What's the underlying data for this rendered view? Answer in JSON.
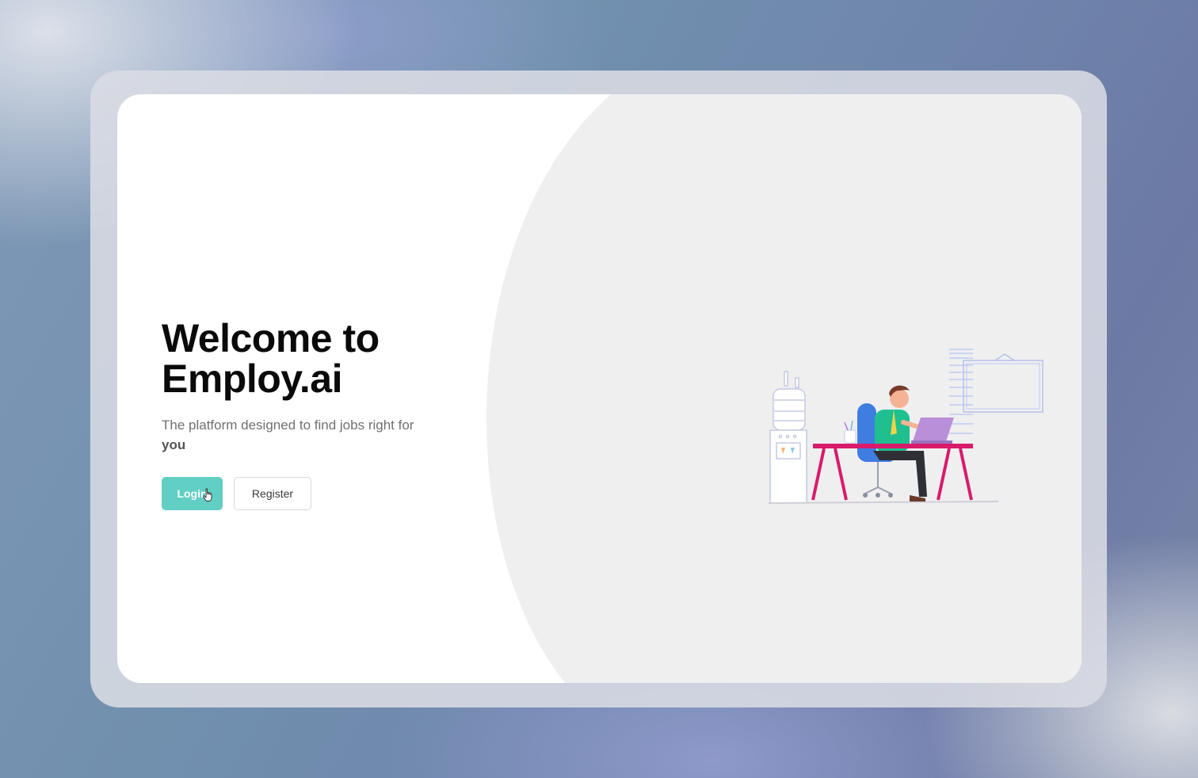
{
  "hero": {
    "title_line1": "Welcome to",
    "title_line2": "Employ.ai",
    "subtitle_text": "The platform designed to find jobs right for",
    "subtitle_emphasis": "you"
  },
  "actions": {
    "login_label": "Login",
    "register_label": "Register"
  },
  "colors": {
    "accent": "#62cfc4",
    "panel": "#efeff0",
    "desk": "#d81b6a",
    "laptop": "#b88fd8",
    "shirt": "#1fbf8f",
    "chair": "#3f7de0"
  },
  "icons": {
    "cursor": "hand-pointer-icon",
    "illustration": "office-worker-illustration"
  }
}
